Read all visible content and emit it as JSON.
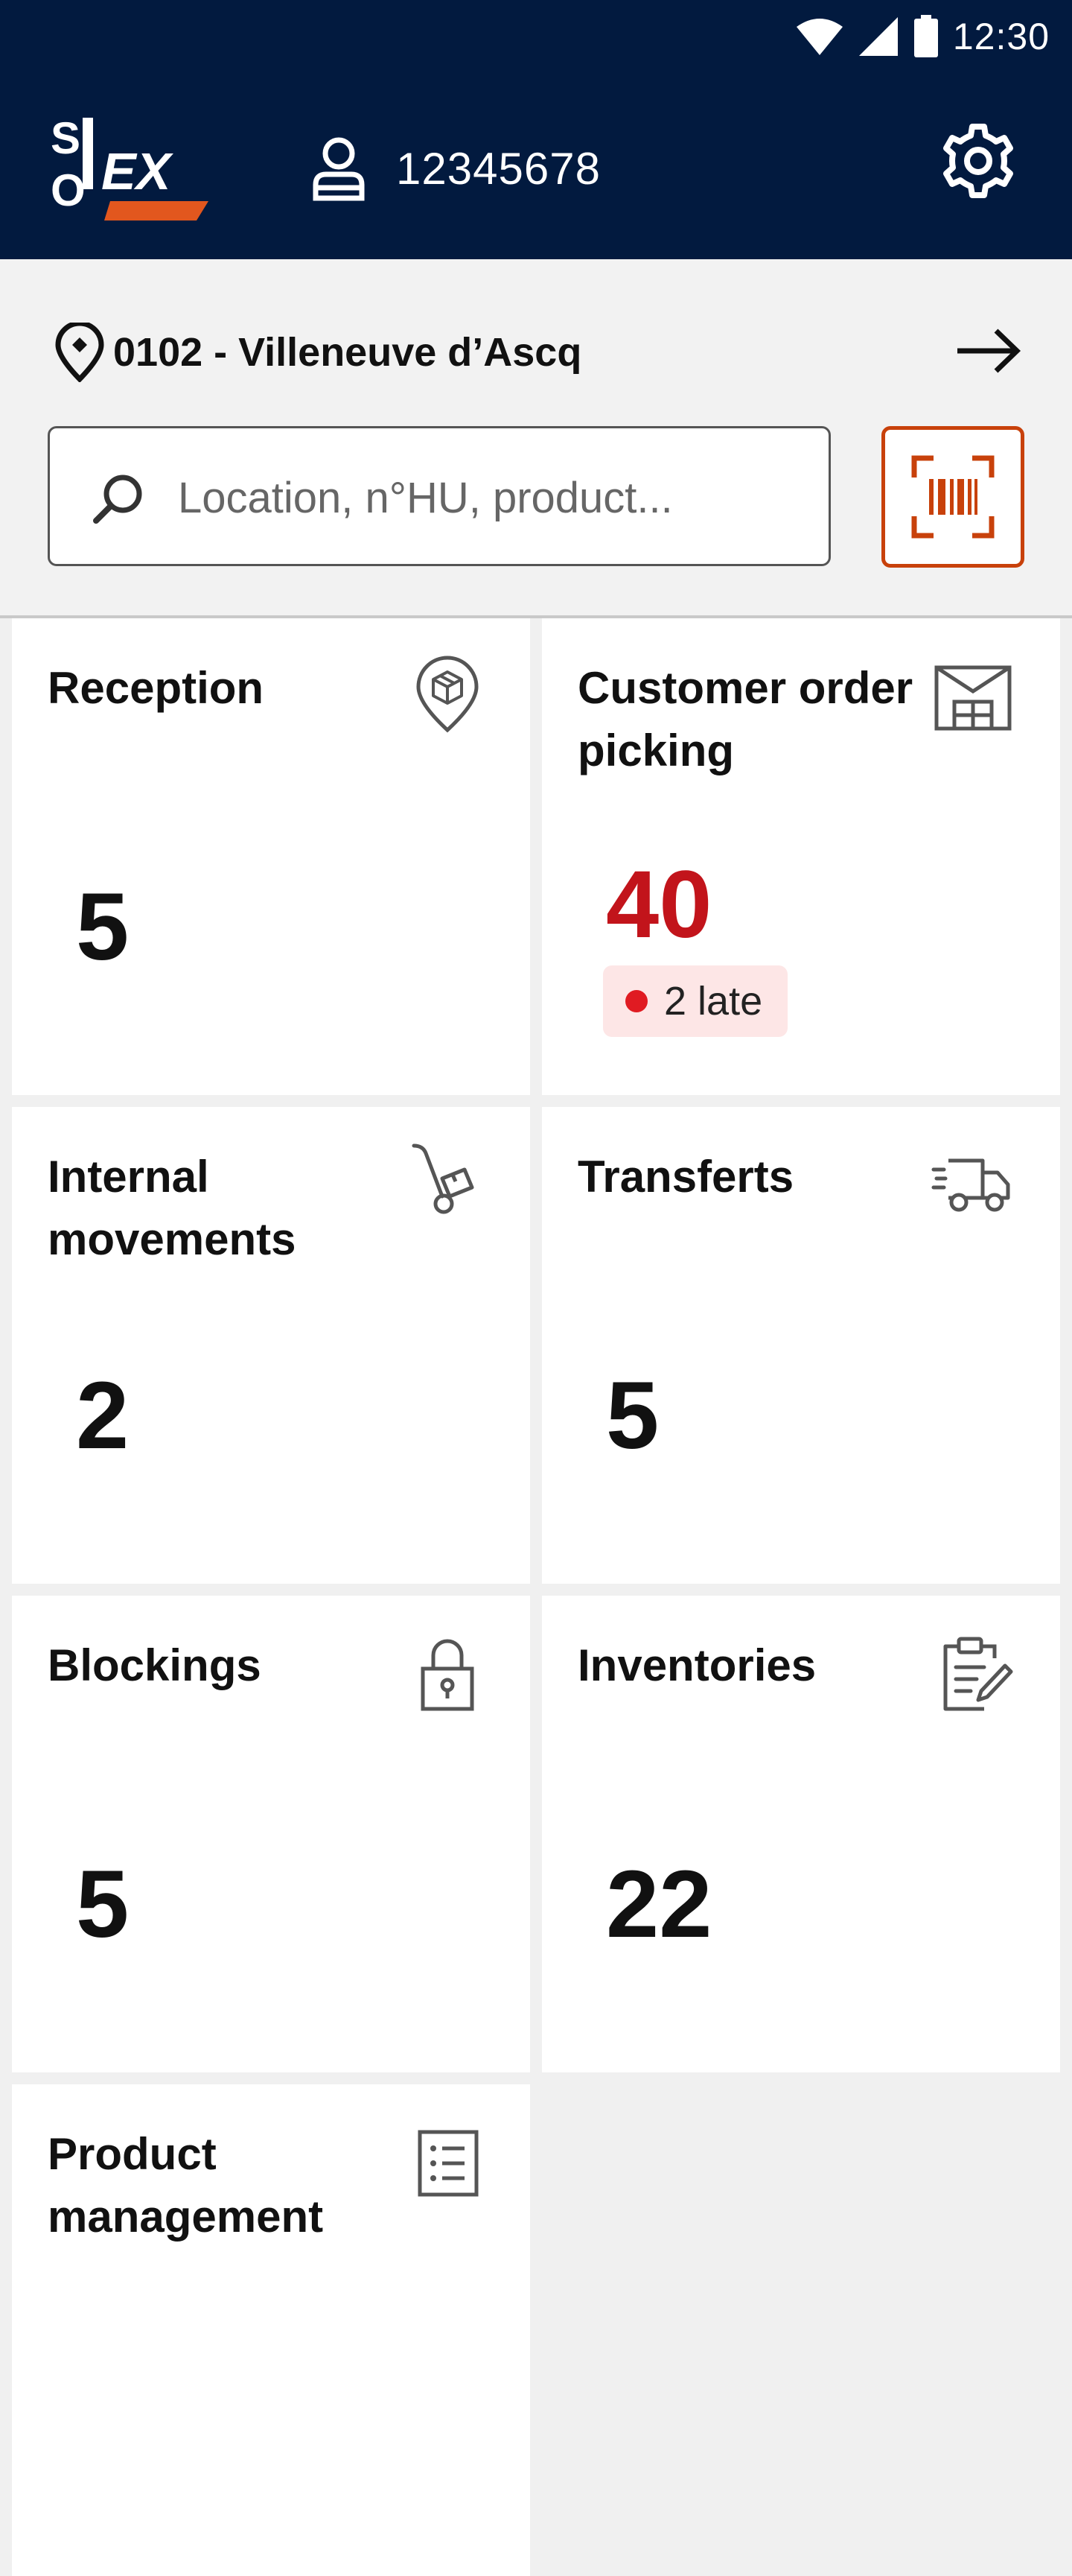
{
  "status_bar": {
    "time": "12:30"
  },
  "header": {
    "logo_text": "SOLEX",
    "user_id": "12345678"
  },
  "site": {
    "label": "0102 - Villeneuve d’Ascq"
  },
  "search": {
    "placeholder": "Location, n°HU, product..."
  },
  "colors": {
    "header_bg": "#021a3f",
    "accent": "#c8410b",
    "alert": "#c2141b",
    "late_badge_bg": "#fde6e6"
  },
  "cards": [
    {
      "title": "Reception",
      "count": "5",
      "icon": "location-box-icon"
    },
    {
      "title": "Customer order picking",
      "count": "40",
      "late": "2 late",
      "icon": "warehouse-icon"
    },
    {
      "title": "Internal movements",
      "count": "2",
      "icon": "hand-truck-icon"
    },
    {
      "title": "Transferts",
      "count": "5",
      "icon": "delivery-truck-icon"
    },
    {
      "title": "Blockings",
      "count": "5",
      "icon": "lock-icon"
    },
    {
      "title": "Inventories",
      "count": "22",
      "icon": "clipboard-edit-icon"
    },
    {
      "title": "Product management",
      "icon": "list-document-icon"
    }
  ]
}
